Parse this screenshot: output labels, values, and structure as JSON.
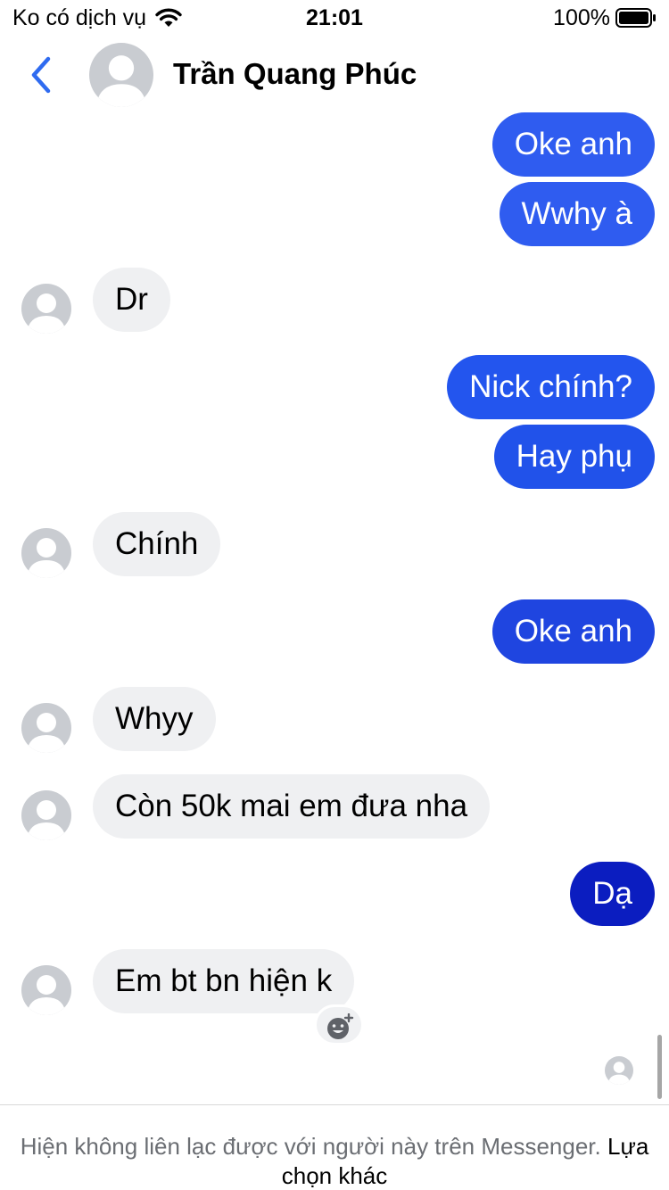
{
  "status_bar": {
    "carrier": "Ko có dịch vụ",
    "time": "21:01",
    "battery": "100%"
  },
  "header": {
    "contact_name": "Trần Quang Phúc"
  },
  "messages": [
    {
      "from": "me",
      "text": "Oke anh",
      "color": "#2f5cf0"
    },
    {
      "from": "me",
      "text": "Wwhy à",
      "color": "#2f5cf0"
    },
    {
      "from": "contact",
      "text": "Dr"
    },
    {
      "from": "me",
      "text": "Nick chính?",
      "color": "#2355ee"
    },
    {
      "from": "me",
      "text": "Hay phụ",
      "color": "#2152ea"
    },
    {
      "from": "contact",
      "text": "Chính"
    },
    {
      "from": "me",
      "text": "Oke anh",
      "color": "#1f45e0"
    },
    {
      "from": "contact",
      "text": "Whyy"
    },
    {
      "from": "contact",
      "text": "Còn 50k mai em đưa nha"
    },
    {
      "from": "me",
      "text": "Dạ",
      "color": "#0b1dc0"
    },
    {
      "from": "contact",
      "text": "Em bt bn hiện k"
    }
  ],
  "footer": {
    "notice": "Hiện không liên lạc được với người này trên Messenger.",
    "link": "Lựa chọn khác"
  },
  "colors": {
    "accent": "#2f6bf0",
    "incoming_bubble": "#eff0f2",
    "avatar_placeholder": "#c9ccd1"
  },
  "icons": [
    "wifi-icon",
    "battery-icon",
    "back-chevron-icon",
    "avatar-placeholder-icon",
    "add-reaction-icon"
  ]
}
